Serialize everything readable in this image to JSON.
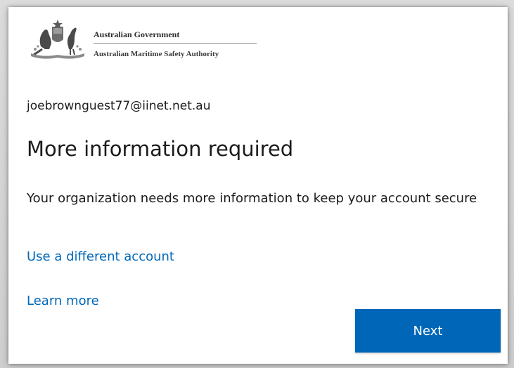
{
  "branding": {
    "line1": "Australian Government",
    "line2": "Australian Maritime Safety Authority"
  },
  "account": {
    "email": "joebrownguest77@iinet.net.au"
  },
  "main": {
    "title": "More information required",
    "description": "Your organization needs more information to keep your account secure"
  },
  "links": {
    "different_account": "Use a different account",
    "learn_more": "Learn more"
  },
  "actions": {
    "next_label": "Next"
  },
  "colors": {
    "accent": "#0067b8",
    "link": "#0067b8",
    "text": "#1b1b1b"
  }
}
